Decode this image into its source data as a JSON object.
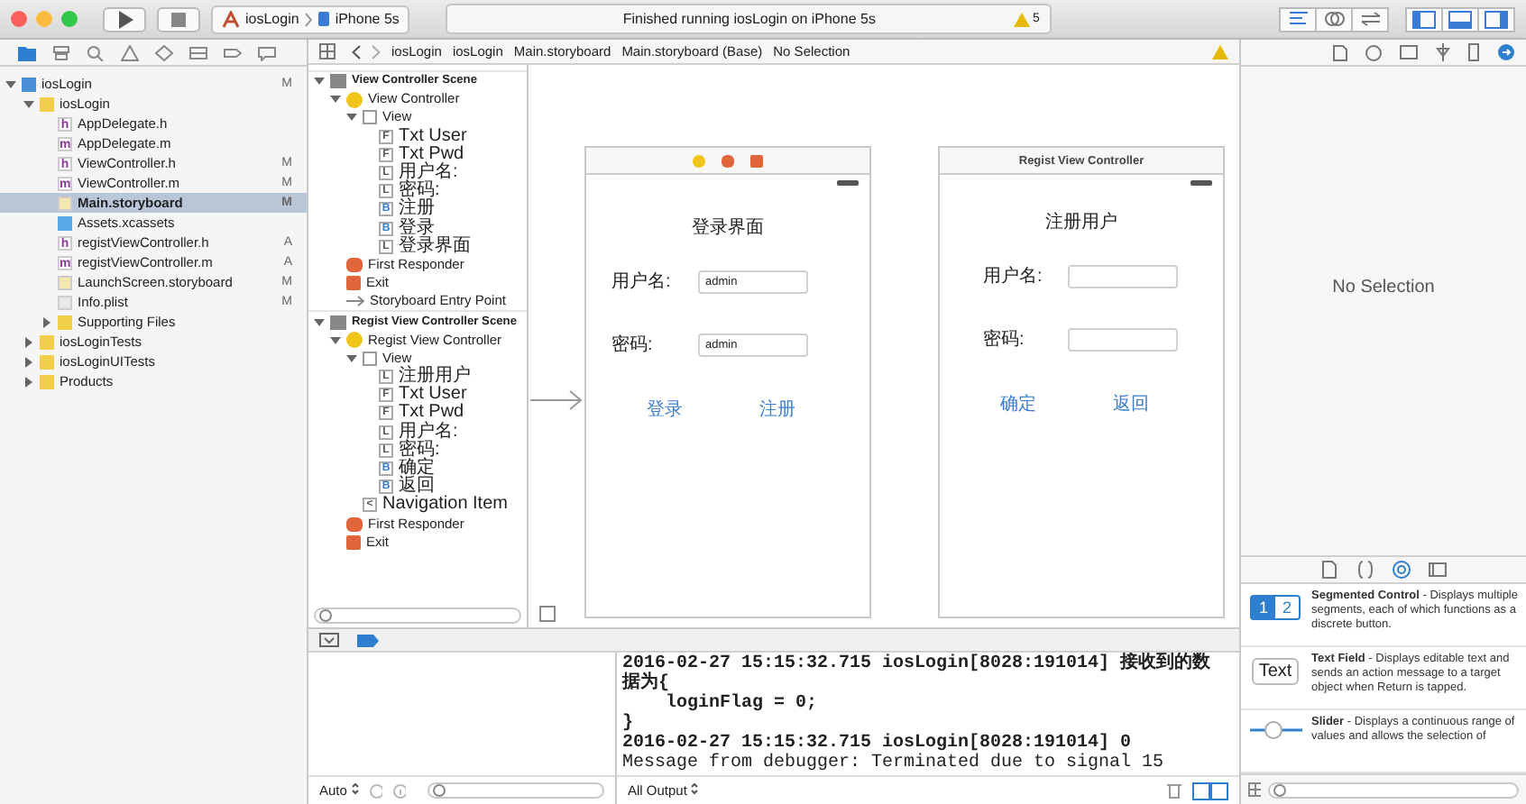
{
  "toolbar": {
    "scheme": "iosLogin",
    "device": "iPhone 5s",
    "status": "Finished running iosLogin on iPhone 5s",
    "warning_count": "5"
  },
  "editor_modes": [
    {
      "kind": "standard",
      "selected": true
    },
    {
      "kind": "assistant",
      "selected": false
    },
    {
      "kind": "version",
      "selected": false
    }
  ],
  "panels": [
    {
      "kind": "navigator",
      "on": true
    },
    {
      "kind": "debug",
      "on": true
    },
    {
      "kind": "utilities",
      "on": true
    }
  ],
  "navigator_tabs": [
    {
      "kind": "folder",
      "selected": true
    },
    {
      "kind": "symbol",
      "selected": false
    },
    {
      "kind": "search",
      "selected": false
    },
    {
      "kind": "warning",
      "selected": false
    },
    {
      "kind": "test",
      "selected": false
    },
    {
      "kind": "debug",
      "selected": false
    },
    {
      "kind": "breakpoint",
      "selected": false
    },
    {
      "kind": "report",
      "selected": false
    }
  ],
  "files": [
    {
      "name": "iosLogin",
      "kind": "project",
      "badge": "M",
      "expanded": true,
      "selected": false,
      "children": [
        {
          "name": "iosLogin",
          "kind": "folder",
          "expanded": true,
          "selected": false,
          "children": [
            {
              "name": "AppDelegate.h",
              "kind": "source",
              "glyph": "h",
              "selected": false
            },
            {
              "name": "AppDelegate.m",
              "kind": "source",
              "glyph": "m",
              "selected": false
            },
            {
              "name": "ViewController.h",
              "kind": "source",
              "glyph": "h",
              "badge": "M",
              "selected": false
            },
            {
              "name": "ViewController.m",
              "kind": "source",
              "glyph": "m",
              "badge": "M",
              "selected": false
            },
            {
              "name": "Main.storyboard",
              "kind": "storyboard",
              "badge": "M",
              "selected": true
            },
            {
              "name": "Assets.xcassets",
              "kind": "assets",
              "selected": false
            },
            {
              "name": "registViewController.h",
              "kind": "source",
              "glyph": "h",
              "badge": "A",
              "selected": false
            },
            {
              "name": "registViewController.m",
              "kind": "source",
              "glyph": "m",
              "badge": "A",
              "selected": false
            },
            {
              "name": "LaunchScreen.storyboard",
              "kind": "storyboard",
              "badge": "M",
              "selected": false
            },
            {
              "name": "Info.plist",
              "kind": "plist",
              "badge": "M",
              "selected": false
            },
            {
              "name": "Supporting Files",
              "kind": "folder",
              "expanded": false,
              "selected": false
            }
          ]
        },
        {
          "name": "iosLoginTests",
          "kind": "folder",
          "expanded": false,
          "selected": false
        },
        {
          "name": "iosLoginUITests",
          "kind": "folder",
          "expanded": false,
          "selected": false
        },
        {
          "name": "Products",
          "kind": "folder",
          "expanded": false,
          "selected": false
        }
      ]
    }
  ],
  "jump_bar": [
    "iosLogin",
    "iosLogin",
    "Main.storyboard",
    "Main.storyboard (Base)",
    "No Selection"
  ],
  "outline": [
    {
      "name": "View Controller Scene",
      "kind": "scene",
      "expanded": true,
      "children": [
        {
          "name": "View Controller",
          "kind": "controller",
          "expanded": true,
          "children": [
            {
              "name": "View",
              "kind": "view",
              "expanded": true,
              "children": [
                {
                  "name": "Txt User",
                  "kind": "field",
                  "glyph": "F"
                },
                {
                  "name": "Txt Pwd",
                  "kind": "field",
                  "glyph": "F"
                },
                {
                  "name": "用户名:",
                  "kind": "label",
                  "glyph": "L"
                },
                {
                  "name": "密码:",
                  "kind": "label",
                  "glyph": "L"
                },
                {
                  "name": "注册",
                  "kind": "button",
                  "glyph": "B"
                },
                {
                  "name": "登录",
                  "kind": "button",
                  "glyph": "B"
                },
                {
                  "name": "登录界面",
                  "kind": "label",
                  "glyph": "L"
                }
              ]
            }
          ]
        },
        {
          "name": "First Responder",
          "kind": "responder"
        },
        {
          "name": "Exit",
          "kind": "exit"
        },
        {
          "name": "Storyboard Entry Point",
          "kind": "entry"
        }
      ]
    },
    {
      "name": "Regist View Controller Scene",
      "kind": "scene",
      "expanded": true,
      "children": [
        {
          "name": "Regist View Controller",
          "kind": "controller",
          "expanded": true,
          "children": [
            {
              "name": "View",
              "kind": "view",
              "expanded": true,
              "children": [
                {
                  "name": "注册用户",
                  "kind": "label",
                  "glyph": "L"
                },
                {
                  "name": "Txt User",
                  "kind": "field",
                  "glyph": "F"
                },
                {
                  "name": "Txt Pwd",
                  "kind": "field",
                  "glyph": "F"
                },
                {
                  "name": "用户名:",
                  "kind": "label",
                  "glyph": "L"
                },
                {
                  "name": "密码:",
                  "kind": "label",
                  "glyph": "L"
                },
                {
                  "name": "确定",
                  "kind": "button",
                  "glyph": "B"
                },
                {
                  "name": "返回",
                  "kind": "button",
                  "glyph": "B"
                }
              ]
            },
            {
              "name": "Navigation Item",
              "kind": "label",
              "glyph": "<"
            }
          ]
        },
        {
          "name": "First Responder",
          "kind": "responder"
        },
        {
          "name": "Exit",
          "kind": "exit"
        }
      ]
    }
  ],
  "scenes": [
    {
      "header": {
        "kind": "dock"
      },
      "entry_point": true,
      "title": "登录界面",
      "fields": [
        {
          "label": "用户名:",
          "value": "admin"
        },
        {
          "label": "密码:",
          "value": "admin"
        }
      ],
      "buttons": [
        "登录",
        "注册"
      ]
    },
    {
      "header": {
        "kind": "title",
        "title": "Regist View Controller"
      },
      "entry_point": false,
      "title": "注册用户",
      "fields": [
        {
          "label": "用户名:"
        },
        {
          "label": "密码:"
        }
      ],
      "buttons": [
        "确定",
        "返回"
      ]
    }
  ],
  "inspector": {
    "empty_text": "No Selection",
    "library_tabs": [
      {
        "kind": "file",
        "selected": false
      },
      {
        "kind": "code",
        "selected": false
      },
      {
        "kind": "object",
        "selected": true
      },
      {
        "kind": "media",
        "selected": false
      }
    ],
    "library": [
      {
        "kind": "segmented",
        "preview": [
          "1",
          "2"
        ],
        "text": "**Segmented Control** - Displays multiple segments, each of which functions as a discrete button."
      },
      {
        "kind": "textfield",
        "preview": [
          "Text"
        ],
        "text": "**Text Field** - Displays editable text and sends an action message to a target object when Return is tapped."
      },
      {
        "kind": "slider",
        "text": "**Slider** - Displays a continuous range of values and allows the selection of"
      }
    ]
  },
  "debug": {
    "scope": "Auto",
    "output": "All Output",
    "console": [
      "2016-02-27 15:15:32.715 iosLogin[8028:191014] 接收到的数据为{",
      "    loginFlag = 0;",
      "}",
      "2016-02-27 15:15:32.715 iosLogin[8028:191014] 0",
      "Message from debugger: Terminated due to signal 15"
    ]
  }
}
